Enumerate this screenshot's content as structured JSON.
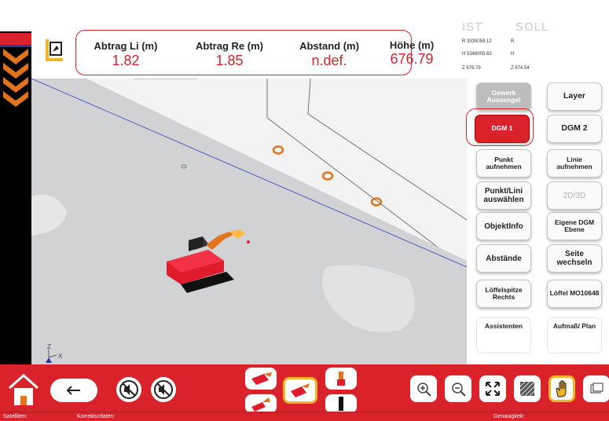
{
  "header": {
    "abtrag_li_label": "Abtrag Li (m)",
    "abtrag_li_value": "1.82",
    "abtrag_re_label": "Abtrag Re (m)",
    "abtrag_re_value": "1.85",
    "abstand_label": "Abstand (m)",
    "abstand_value": "n.def.",
    "hoehe_label": "Höhe (m)",
    "hoehe_value": "676.79"
  },
  "ist_soll": {
    "ist_label": "IST",
    "soll_label": "SOLL",
    "r_ist": "R 3335059.12",
    "r_soll": "R",
    "h_ist": "H 5348005.63",
    "h_soll": "H",
    "z_ist": "Z 676.79",
    "z_soll": "Z 674.54"
  },
  "right_panel": {
    "gewerk": "Gewerk Aussengel",
    "layer": "Layer",
    "dgm1": "DGM 1",
    "dgm2": "DGM 2",
    "punkt_aufnehmen": "Punkt aufnehmen",
    "linie_aufnehmen": "Linie aufnehmen",
    "punkt_linie_auswaehlen": "Punkt/Lini auswählen",
    "view_2d3d": "2D/3D",
    "objektinfo": "ObjektInfo",
    "eigene_dgm": "Eigene DGM Ebene",
    "abstaende": "Abstände",
    "seite_wechseln": "Seite wechseln",
    "loeffelspitze": "Löffelspitze Rechts",
    "loeffel": "Löffel MO10648",
    "assistenten": "Assistenten",
    "aufmass_plan": "Aufmaß/ Plan"
  },
  "statusbar": {
    "satelliten": "Satelliten:",
    "korrekturdaten": "Korrekturdaten:",
    "genauigkeit": "Genauigkeit:"
  },
  "viewport": {
    "axis_z": "Z",
    "axis_x": "X"
  },
  "colors": {
    "accent": "#d9222a",
    "toolbar": "#d9222a",
    "terrain": "#d7d8d9",
    "excavator": "#e01b2b",
    "marker": "#e0731b"
  },
  "icons": {
    "home": "home-icon",
    "back": "arrow-left-icon",
    "no_sound_1": "no-sound-icon",
    "no_sound_2": "no-sound-icon",
    "excavator_view_1": "excavator-view-icon",
    "excavator_view_2": "excavator-view-icon",
    "excavator_view_3": "excavator-view-icon",
    "zoom_in": "zoom-in-icon",
    "zoom_out": "zoom-out-icon",
    "fit": "fit-to-screen-icon",
    "hatch": "hatch-icon",
    "pan": "hand-pan-icon",
    "screenshot": "screenshot-icon"
  }
}
